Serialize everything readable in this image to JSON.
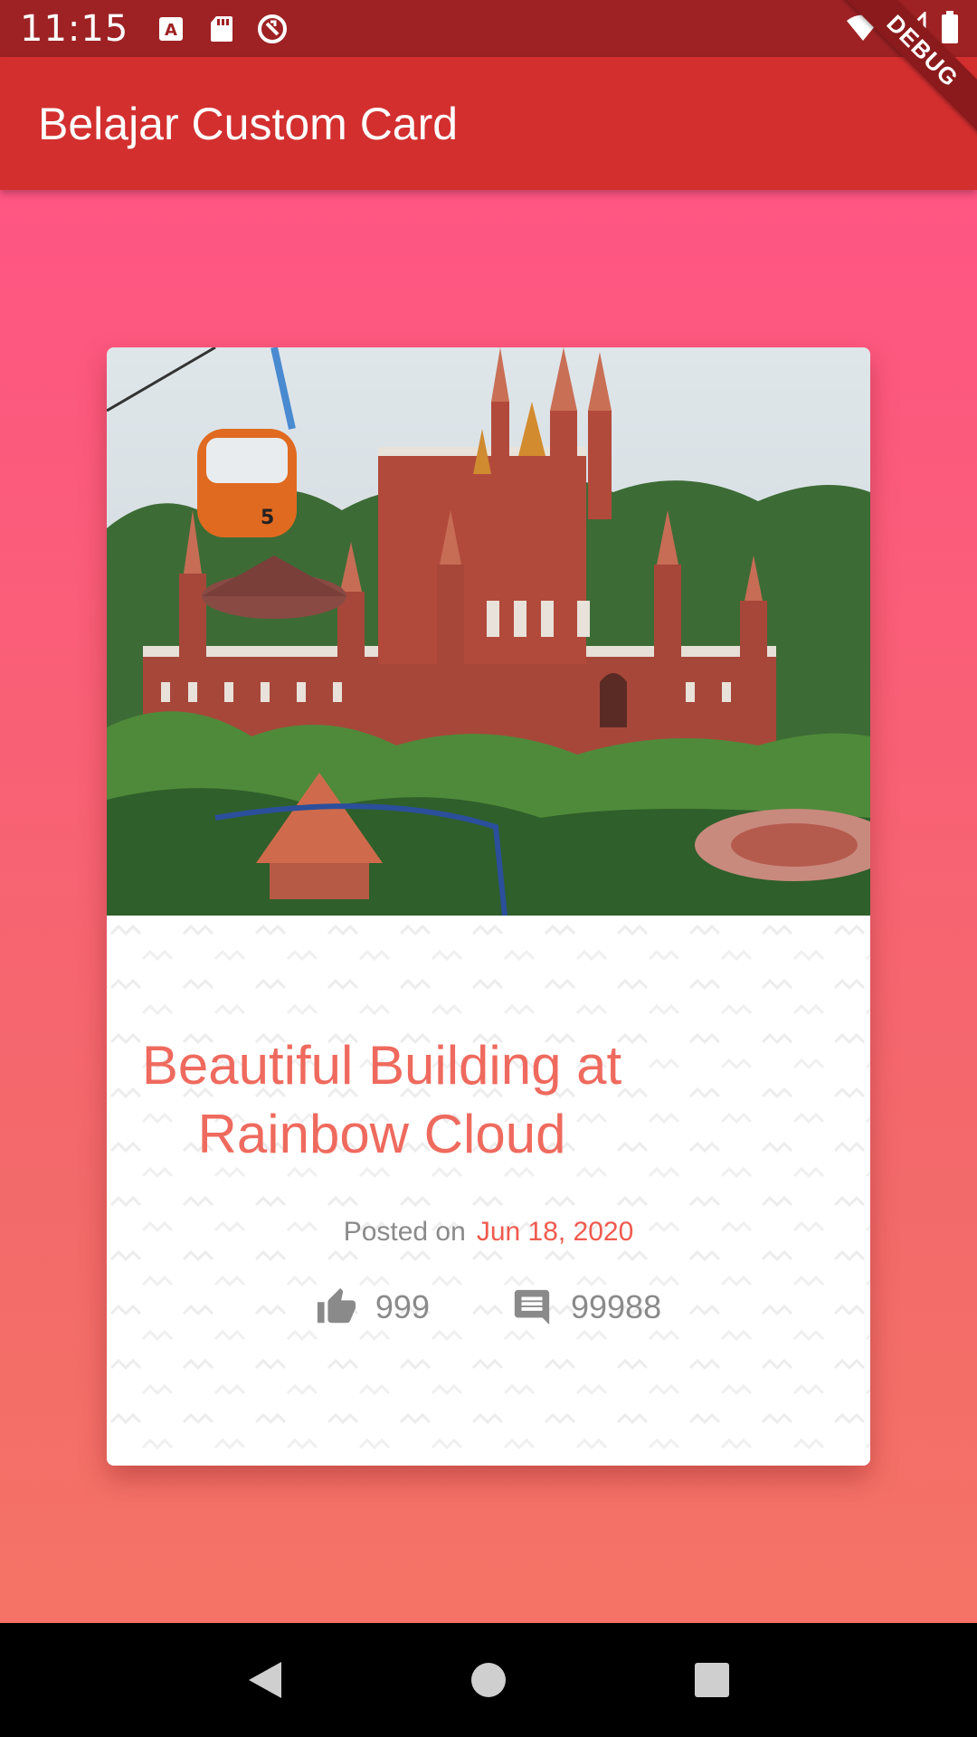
{
  "status_bar": {
    "time": "11:15",
    "left_icons": [
      "a-keyboard-icon",
      "sd-card-icon",
      "data-saver-icon"
    ],
    "right_icons": [
      "wifi-icon",
      "signal-icon",
      "battery-icon"
    ]
  },
  "debug_banner": {
    "label": "DEBUG"
  },
  "app_bar": {
    "title": "Belajar Custom Card"
  },
  "card": {
    "image_icon": "castle-photo",
    "title": "Beautiful Building at Rainbow Cloud",
    "posted_label": "Posted on",
    "posted_date": "Jun 18, 2020",
    "likes": "999",
    "comments": "99988"
  },
  "nav_bar": {
    "buttons": [
      "back-icon",
      "home-icon",
      "recents-icon"
    ]
  },
  "colors": {
    "status_bar": "#9E2224",
    "app_bar": "#D32F2F",
    "background_top": "#FF5583",
    "background_bottom": "#F47366",
    "title": "#EF6A5E",
    "date": "#EF5A4E",
    "muted": "#8A8A8A"
  }
}
